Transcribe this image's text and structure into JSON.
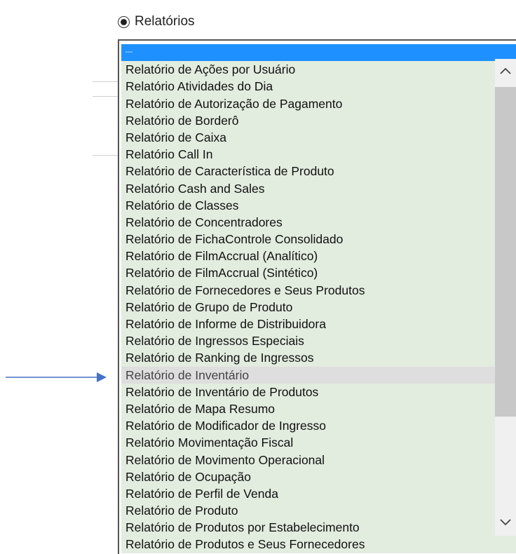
{
  "radio": {
    "label": "Relatórios",
    "checked": true
  },
  "dropdown": {
    "selected_index": 0,
    "hovered_index": 19,
    "items": [
      "---",
      "Relatório de Ações por Usuário",
      "Relatório Atividades do Dia",
      "Relatório de Autorização de Pagamento",
      "Relatório de Borderô",
      "Relatório de Caixa",
      "Relatório Call In",
      "Relatório de Característica de Produto",
      "Relatório Cash and Sales",
      "Relatório de Classes",
      "Relatório de Concentradores",
      "Relatório de FichaControle Consolidado",
      "Relatório de FilmAccrual (Analítico)",
      "Relatório de FilmAccrual (Sintético)",
      "Relatório de Fornecedores e Seus Produtos",
      "Relatório de Grupo de Produto",
      "Relatório de Informe de Distribuidora",
      "Relatório de Ingressos Especiais",
      "Relatório de Ranking de Ingressos",
      "Relatório de Inventário",
      "Relatório de Inventário de Produtos",
      "Relatório de Mapa Resumo",
      "Relatório de Modificador de Ingresso",
      "Relatório Movimentação Fiscal",
      "Relatório de Movimento Operacional",
      "Relatório de Ocupação",
      "Relatório de Perfil de Venda",
      "Relatório de Produto",
      "Relatório de Produtos por Estabelecimento",
      "Relatório de Produtos e Seus Fornecedores"
    ]
  },
  "colors": {
    "selected_bg": "#1e90ff",
    "item_bg": "#e2ecdf",
    "hover_bg": "#dedede",
    "arrow": "#4472c4"
  },
  "icons": {
    "pointer": "arrow-right-icon",
    "scroll_up": "chevron-up-icon",
    "scroll_down": "chevron-down-icon"
  }
}
